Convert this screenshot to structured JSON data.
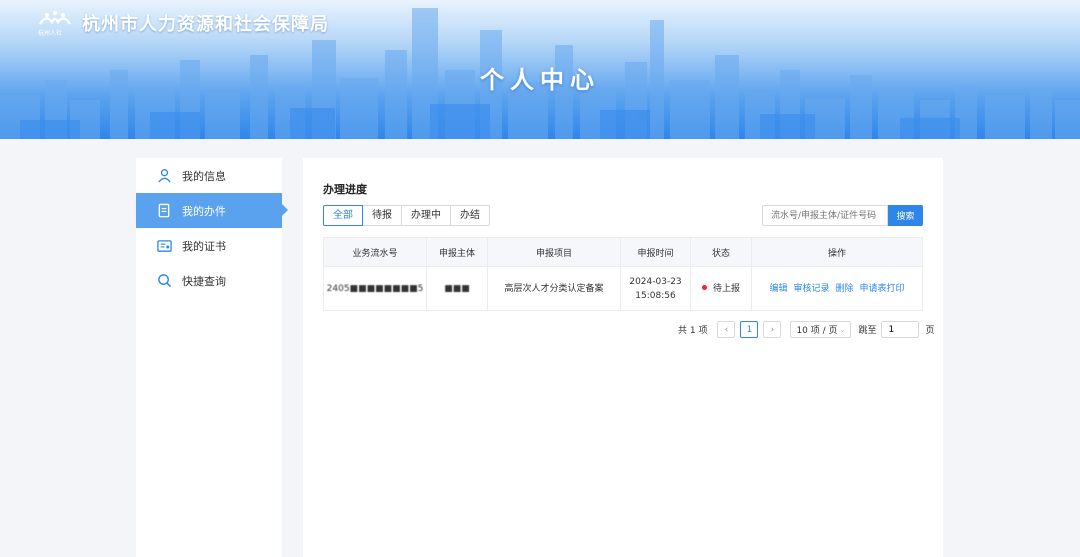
{
  "header": {
    "logo_caption": "杭州人社",
    "org_name": "杭州市人力资源和社会保障局",
    "page_title": "个人中心"
  },
  "sidebar": {
    "items": [
      {
        "label": "我的信息",
        "icon": "user-icon",
        "active": false
      },
      {
        "label": "我的办件",
        "icon": "document-icon",
        "active": true
      },
      {
        "label": "我的证书",
        "icon": "certificate-icon",
        "active": false
      },
      {
        "label": "快捷查询",
        "icon": "search-icon",
        "active": false
      }
    ]
  },
  "main": {
    "section_title": "办理进度",
    "tabs": [
      "全部",
      "待报",
      "办理中",
      "办结"
    ],
    "active_tab": "全部",
    "search": {
      "placeholder": "流水号/申报主体/证件号码",
      "button_label": "搜索"
    },
    "table": {
      "columns": [
        "业务流水号",
        "申报主体",
        "申报项目",
        "申报时间",
        "状态",
        "操作"
      ],
      "rows": [
        {
          "serial": "2405■■■■■■■■5",
          "applicant": "■■■",
          "project": "高层次人才分类认定备案",
          "date": "2024-03-23",
          "time": "15:08:56",
          "status": "待上报",
          "status_color": "#f5222d",
          "actions": [
            "编辑",
            "审核记录",
            "删除",
            "申请表打印"
          ]
        }
      ]
    },
    "pagination": {
      "total": "共 1 项",
      "current_page": "1",
      "page_size": "10 项 / 页",
      "jump_label": "跳至",
      "jump_value": "1",
      "page_unit": "页"
    }
  },
  "colors": {
    "accent": "#2f86ea",
    "sidebar_active": "#5aa2ee",
    "status_dot": "#f5222d"
  }
}
